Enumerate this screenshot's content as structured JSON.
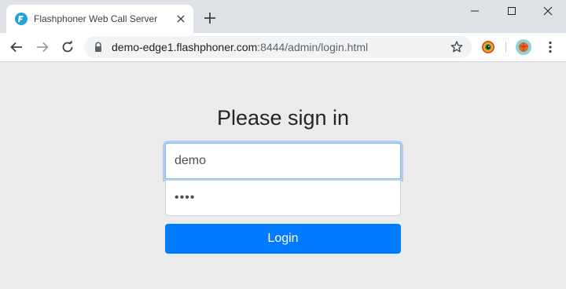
{
  "browser": {
    "tab": {
      "title": "Flashphoner Web Call Server",
      "favicon": "flashphoner-logo-icon",
      "favicon_color": "#20a3d8"
    },
    "new_tab_icon": "plus-icon",
    "window_controls": [
      "minimize-icon",
      "maximize-icon",
      "close-icon"
    ],
    "toolbar": {
      "back_icon": "arrow-left-icon",
      "forward_icon": "arrow-right-icon",
      "reload_icon": "reload-icon",
      "url_host": "demo-edge1.flashphoner.com",
      "url_path": ":8444/admin/login.html",
      "secure_icon": "lock-icon",
      "bookmark_icon": "star-icon",
      "extension_icon": "extension-icon",
      "menu_icon": "kebab-menu-icon"
    }
  },
  "login": {
    "heading": "Please sign in",
    "username_value": "demo",
    "password_value": "demo",
    "button_label": "Login"
  },
  "colors": {
    "page_background": "#ebebeb",
    "primary_button": "#007bff",
    "focus_border": "#80bdff"
  }
}
